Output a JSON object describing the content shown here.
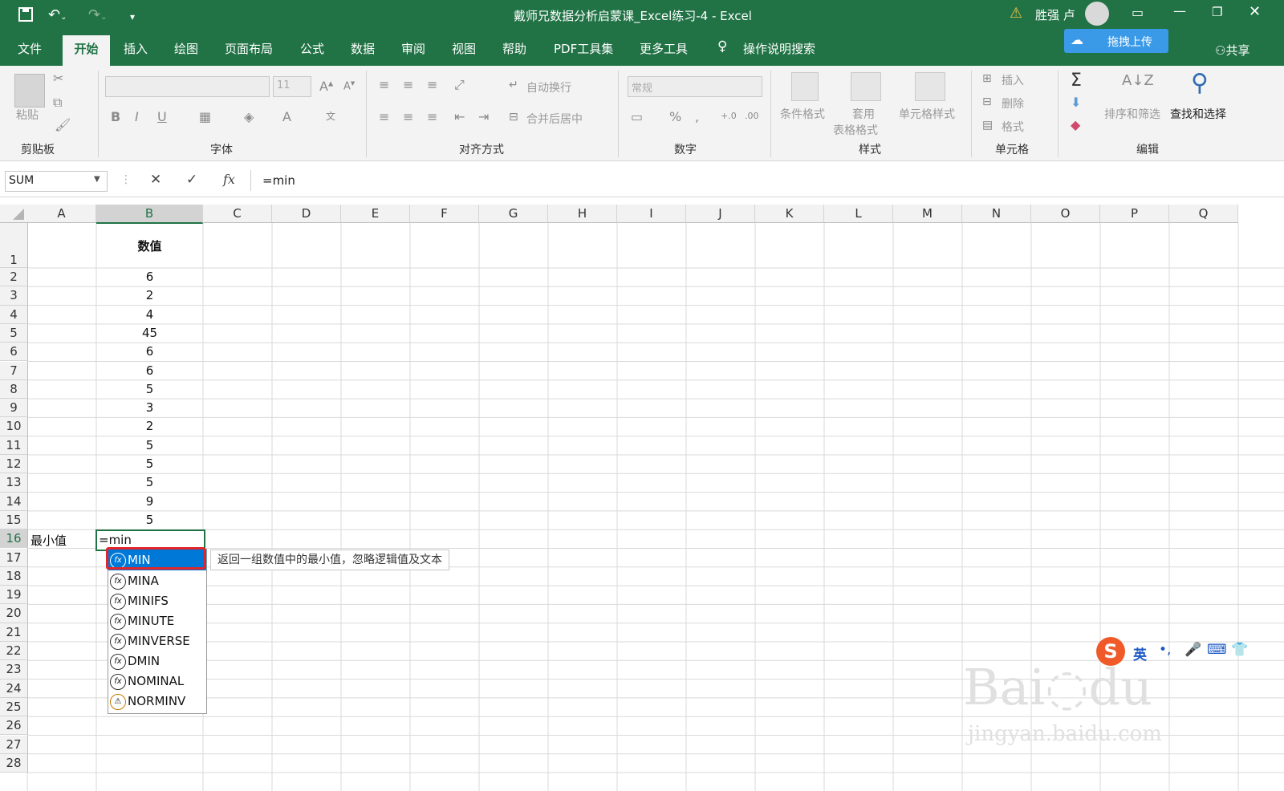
{
  "window": {
    "title": "戴师兄数据分析启蒙课_Excel练习-4  -  Excel",
    "user": "胜强 卢",
    "upload_button": "拖拽上传",
    "share": "共享"
  },
  "tabs": [
    "文件",
    "开始",
    "插入",
    "绘图",
    "页面布局",
    "公式",
    "数据",
    "审阅",
    "视图",
    "帮助",
    "PDF工具集",
    "更多工具"
  ],
  "active_tab": "开始",
  "search_hint": "操作说明搜索",
  "ribbon": {
    "clipboard": {
      "paste": "粘贴",
      "label": "剪贴板"
    },
    "font": {
      "font_size": "11",
      "label": "字体"
    },
    "alignment": {
      "wrap": "自动换行",
      "merge": "合并后居中",
      "label": "对齐方式"
    },
    "number": {
      "format": "常规",
      "label": "数字"
    },
    "styles": {
      "conditional": "条件格式",
      "table_line1": "套用",
      "table_line2": "表格格式",
      "cell_styles": "单元格样式",
      "label": "样式"
    },
    "cells": {
      "insert": "插入",
      "delete": "删除",
      "format": "格式",
      "label": "单元格"
    },
    "editing": {
      "sort": "排序和筛选",
      "find": "查找和选择",
      "label": "编辑"
    }
  },
  "formula_bar": {
    "name_box": "SUM",
    "formula": "=min"
  },
  "columns": [
    "A",
    "B",
    "C",
    "D",
    "E",
    "F",
    "G",
    "H",
    "I",
    "J",
    "K",
    "L",
    "M",
    "N",
    "O",
    "P",
    "Q"
  ],
  "rows": [
    "1",
    "2",
    "3",
    "4",
    "5",
    "6",
    "7",
    "8",
    "9",
    "10",
    "11",
    "12",
    "13",
    "14",
    "15",
    "16",
    "17",
    "18",
    "19",
    "20",
    "21",
    "22",
    "23",
    "24",
    "25",
    "26",
    "27",
    "28"
  ],
  "header_b1": "数值",
  "values_b": [
    "6",
    "2",
    "4",
    "45",
    "6",
    "6",
    "5",
    "3",
    "2",
    "5",
    "5",
    "5",
    "9",
    "5"
  ],
  "label_a16": "最小值",
  "editing_cell": "=min",
  "autocomplete": {
    "items": [
      "MIN",
      "MINA",
      "MINIFS",
      "MINUTE",
      "MINVERSE",
      "DMIN",
      "NOMINAL",
      "NORMINV"
    ],
    "selected": "MIN",
    "tooltip": "返回一组数值中的最小值，忽略逻辑值及文本"
  },
  "ime": {
    "lang": "英"
  },
  "colors": {
    "excel_green": "#217346",
    "selection_blue": "#0078d7",
    "highlight_red": "#e0262a"
  }
}
